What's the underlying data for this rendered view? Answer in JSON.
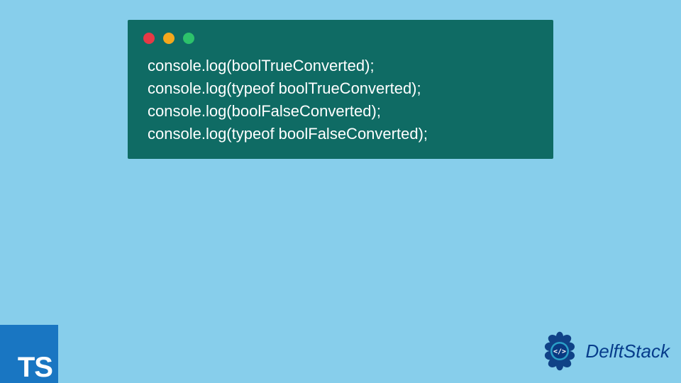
{
  "code": {
    "lines": [
      "console.log(boolTrueConverted);",
      "console.log(typeof boolTrueConverted);",
      "console.log(boolFalseConverted);",
      "console.log(typeof boolFalseConverted);"
    ]
  },
  "ts_badge": {
    "label": "TS"
  },
  "brand": {
    "name": "DelftStack",
    "code_glyph": "</>"
  },
  "colors": {
    "background": "#87ceeb",
    "code_window": "#0f6b64",
    "ts_badge": "#1976c2",
    "brand_text": "#063c8b"
  }
}
